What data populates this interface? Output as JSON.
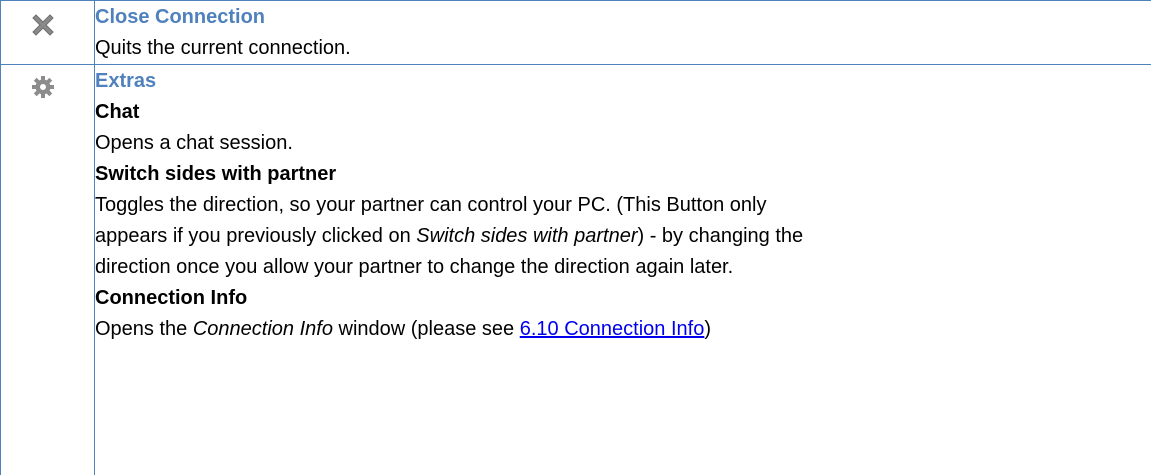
{
  "close_connection": {
    "icon": "close-icon",
    "title": "Close Connection",
    "description": "Quits the current connection."
  },
  "extras": {
    "icon": "gear-icon",
    "title": "Extras",
    "chat": {
      "title": "Chat",
      "description": "Opens a chat session."
    },
    "switch_sides": {
      "title": "Switch sides with partner",
      "line1": "Toggles the direction, so your partner can control your PC. (This Button only",
      "line2_before": "appears if you previously clicked on ",
      "line2_italic": "Switch sides with partner",
      "line2_after": ") - by changing the",
      "line3": "direction once you allow your partner to change the direction again later."
    },
    "connection_info": {
      "title": "Connection Info",
      "desc_before": "Opens the ",
      "desc_italic": "Connection Info",
      "desc_middle": " window (please see ",
      "link_text": "6.10 Connection Info",
      "desc_after": ")"
    }
  },
  "colors": {
    "heading": "#4f81bd",
    "border": "#4f81bd",
    "link": "#0000ee"
  }
}
